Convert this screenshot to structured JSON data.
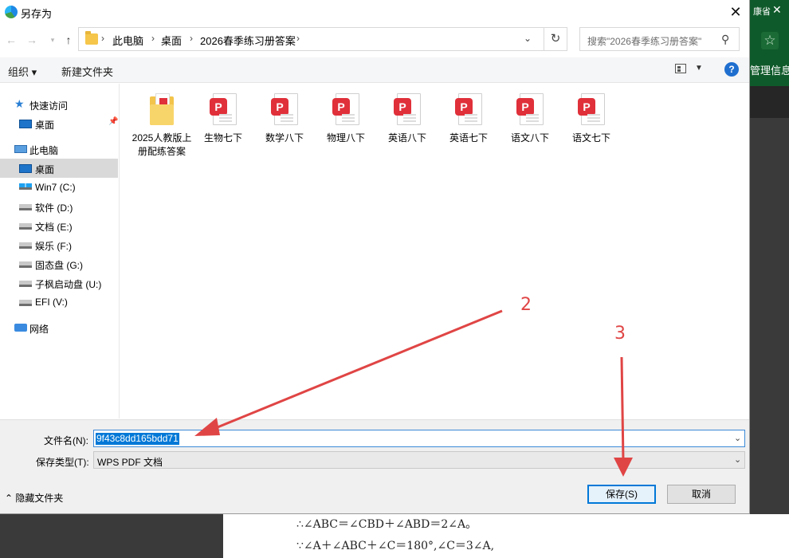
{
  "window": {
    "title": "另存为"
  },
  "background": {
    "tab_text": "康省",
    "close_glyph": "✕",
    "manage_text": "管理信息",
    "doc_lines": [
      "∴∠ABC＝∠CBD＋∠ABD＝2∠A。",
      "∵∠A＋∠ABC＋∠C＝180°,∠C＝3∠A,"
    ]
  },
  "address": {
    "crumbs": [
      "此电脑",
      "桌面",
      "2026春季练习册答案"
    ],
    "search_placeholder": "搜索\"2026春季练习册答案\""
  },
  "toolbar": {
    "organize": "组织 ▾",
    "new_folder": "新建文件夹",
    "help": "?"
  },
  "navpane": {
    "quick_access": "快速访问",
    "quick_desktop": "桌面",
    "this_pc": "此电脑",
    "pc_desktop": "桌面",
    "drives": [
      "Win7 (C:)",
      "软件 (D:)",
      "文档 (E:)",
      "娱乐 (F:)",
      "固态盘 (G:)",
      "子枫启动盘 (U:)",
      "EFI (V:)"
    ],
    "network": "网络"
  },
  "files": [
    {
      "name": "2025人教版上册配练答案",
      "type": "folder"
    },
    {
      "name": "生物七下",
      "type": "pdf"
    },
    {
      "name": "数学八下",
      "type": "pdf"
    },
    {
      "name": "物理八下",
      "type": "pdf"
    },
    {
      "name": "英语八下",
      "type": "pdf"
    },
    {
      "name": "英语七下",
      "type": "pdf"
    },
    {
      "name": "语文八下",
      "type": "pdf"
    },
    {
      "name": "语文七下",
      "type": "pdf"
    }
  ],
  "form": {
    "filename_label": "文件名(N):",
    "filename_value": "9f43c8dd165bdd71",
    "filetype_label": "保存类型(T):",
    "filetype_value": "WPS PDF 文档",
    "hide_folders": "隐藏文件夹",
    "save": "保存(S)",
    "cancel": "取消"
  },
  "annotations": {
    "arrow2_label": "2",
    "arrow3_label": "3",
    "arrow_color": "#e04545"
  },
  "icons": {
    "back": "back-arrow-icon",
    "forward": "forward-arrow-icon",
    "up": "up-arrow-icon",
    "refresh": "refresh-icon",
    "search": "search-icon",
    "pdf": "wps-pdf-icon",
    "folder": "folder-icon"
  }
}
